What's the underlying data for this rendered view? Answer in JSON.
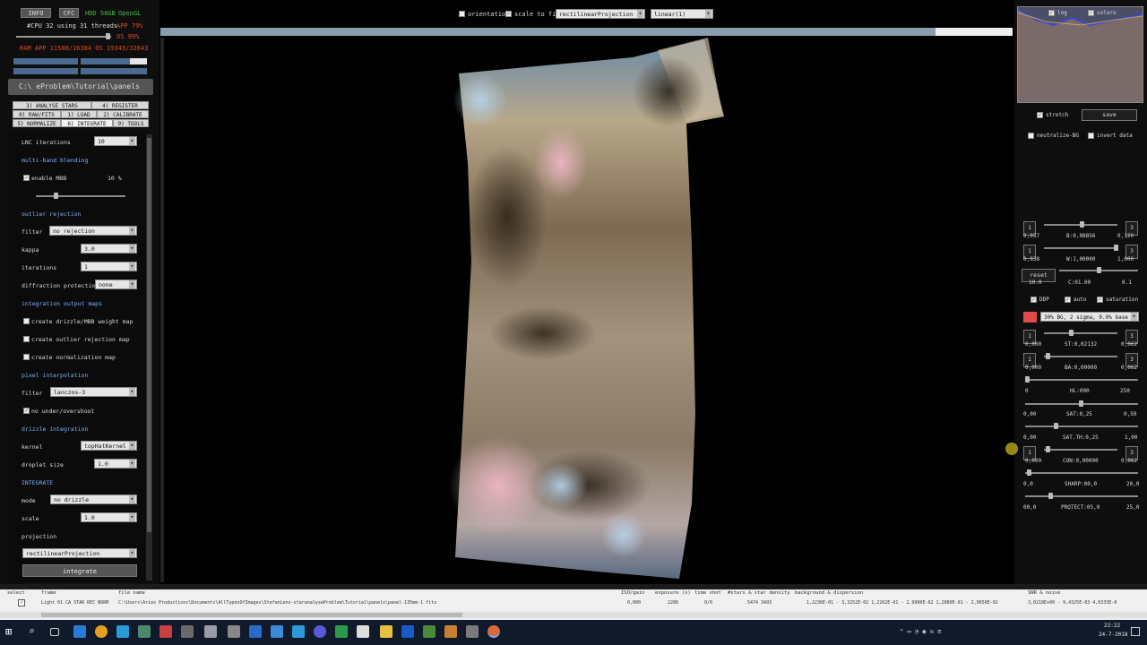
{
  "header": {
    "info": "INFO",
    "cfc": "CFC",
    "hdd": "HDD 58GB",
    "opengl": "OpenGL",
    "cpu": "#CPU 32  using 31 threads",
    "app": "APP 79%",
    "os_pct": "OS 99%",
    "ram": "RAM  APP 11588/16384  OS 19343/32643",
    "path": "C:\\    eProblem\\Tutorial\\panels"
  },
  "tabs": [
    "3) ANALYSE STARS",
    "4) REGISTER",
    "0) RAW/FITS",
    "1) LOAD",
    "2) CALIBRATE",
    "5) NORMALIZE",
    "6) INTEGRATE",
    "9) TOOLS"
  ],
  "options": {
    "lnc_label": "LNC iterations",
    "lnc_value": "10",
    "mbb_section": "multi-band blending",
    "mbb_enable": "enable MBB",
    "mbb_pct": "10  %",
    "outlier_section": "outlier rejection",
    "filter_label": "filter",
    "filter_value": "no rejection",
    "kappa_label": "kappa",
    "kappa_value": "3.0",
    "iter_label": "iterations",
    "iter_value": "1",
    "diff_label": "diffraction protection",
    "diff_value": "none",
    "maps_section": "integration output maps",
    "map1": "create drizzle/MBB weight map",
    "map2": "create outlier rejection map",
    "map3": "create normalization map",
    "pixel_section": "pixel interpolation",
    "pfilter_label": "filter",
    "pfilter_value": "lanczos-3",
    "undershoot": "no under/overshoot",
    "drizzle_section": "drizzle integration",
    "kernel_label": "kernel",
    "kernel_value": "topHatKernel",
    "droplet_label": "droplet size",
    "droplet_value": "1.0",
    "integrate_section": "INTEGRATE",
    "mode_label": "mode",
    "mode_value": "no drizzle",
    "scale_label": "scale",
    "scale_value": "1.0",
    "projection_label": "projection",
    "projection_value": "rectilinearProjection",
    "integrate_button": "integrate"
  },
  "topbar": {
    "orientation": "orientation",
    "scale_to_fit": "scale to fit",
    "projection": "rectilinearProjection",
    "stretch": "linear(1)",
    "progress": 0.91
  },
  "right": {
    "log": "log",
    "colors": "colors",
    "stretch": "stretch",
    "save": "save",
    "neutralize": "neutralize-BG",
    "invert": "invert data",
    "b_left": "0,057",
    "b_mid": "B:0,08856",
    "b_right": "0,120",
    "w_left": "0,938",
    "w_mid": "W:1,00000",
    "w_right": "1,000",
    "reset": "reset",
    "c_left": "10.0",
    "c_mid": "C:01.00",
    "c_right": "0.1",
    "ddp": "DDP",
    "auto": "auto",
    "saturation": "saturation",
    "bg_preset": "30% BG, 2 sigma, 0.0% base",
    "st_left": "0,000",
    "st_mid": "ST:0,02132",
    "st_right": "0,062",
    "ba_left": "0,000",
    "ba_mid": "BA:0,00000",
    "ba_right": "0,062",
    "hl_left": "0",
    "hl_mid": "HL:000",
    "hl_right": "250",
    "sat_left": "0,00",
    "sat_mid": "SAT:0,25",
    "sat_right": "0,50",
    "sth_left": "0,00",
    "sth_mid": "SAT.TH:0,25",
    "sth_right": "1,00",
    "con_left": "0,000",
    "con_mid": "CON:0,00000",
    "con_right": "0,062",
    "sharp_left": "0,0",
    "sharp_mid": "SHARP:00,0",
    "sharp_right": "20,0",
    "prot_left": "00,0",
    "prot_mid": "PROTECT:05,0",
    "prot_right": "25,0",
    "one": "1",
    "three": "3"
  },
  "table": {
    "headers": [
      "select",
      "frame",
      "file name",
      "ISO/gain",
      "exposure (s)",
      "time shot",
      "#stars & star density",
      "background & dispersion",
      "SNR & noise"
    ],
    "row1": {
      "frame": "Light 01  CA STAR REC NORM",
      "file": "C:\\Users\\Aries Productions\\Documents\\AllTypesOfImages\\StefanLenz-staranalyseProblem\\Tutorial\\panels\\panel-135mm-1 fits",
      "iso": "0,000",
      "exp": "2286",
      "time": "0/0",
      "stars": "5474 3493",
      "bg": "1,2236E-01 -  3,3252E-02    1,2262E-01 -  2,9990E-02    1,2080E-01 -  2,9650E-02",
      "snr": "3,0218E+00 -  9,4325E-03    4,0333E-0"
    }
  },
  "taskbar": {
    "time": "22:22",
    "date": "24-7-2018"
  }
}
